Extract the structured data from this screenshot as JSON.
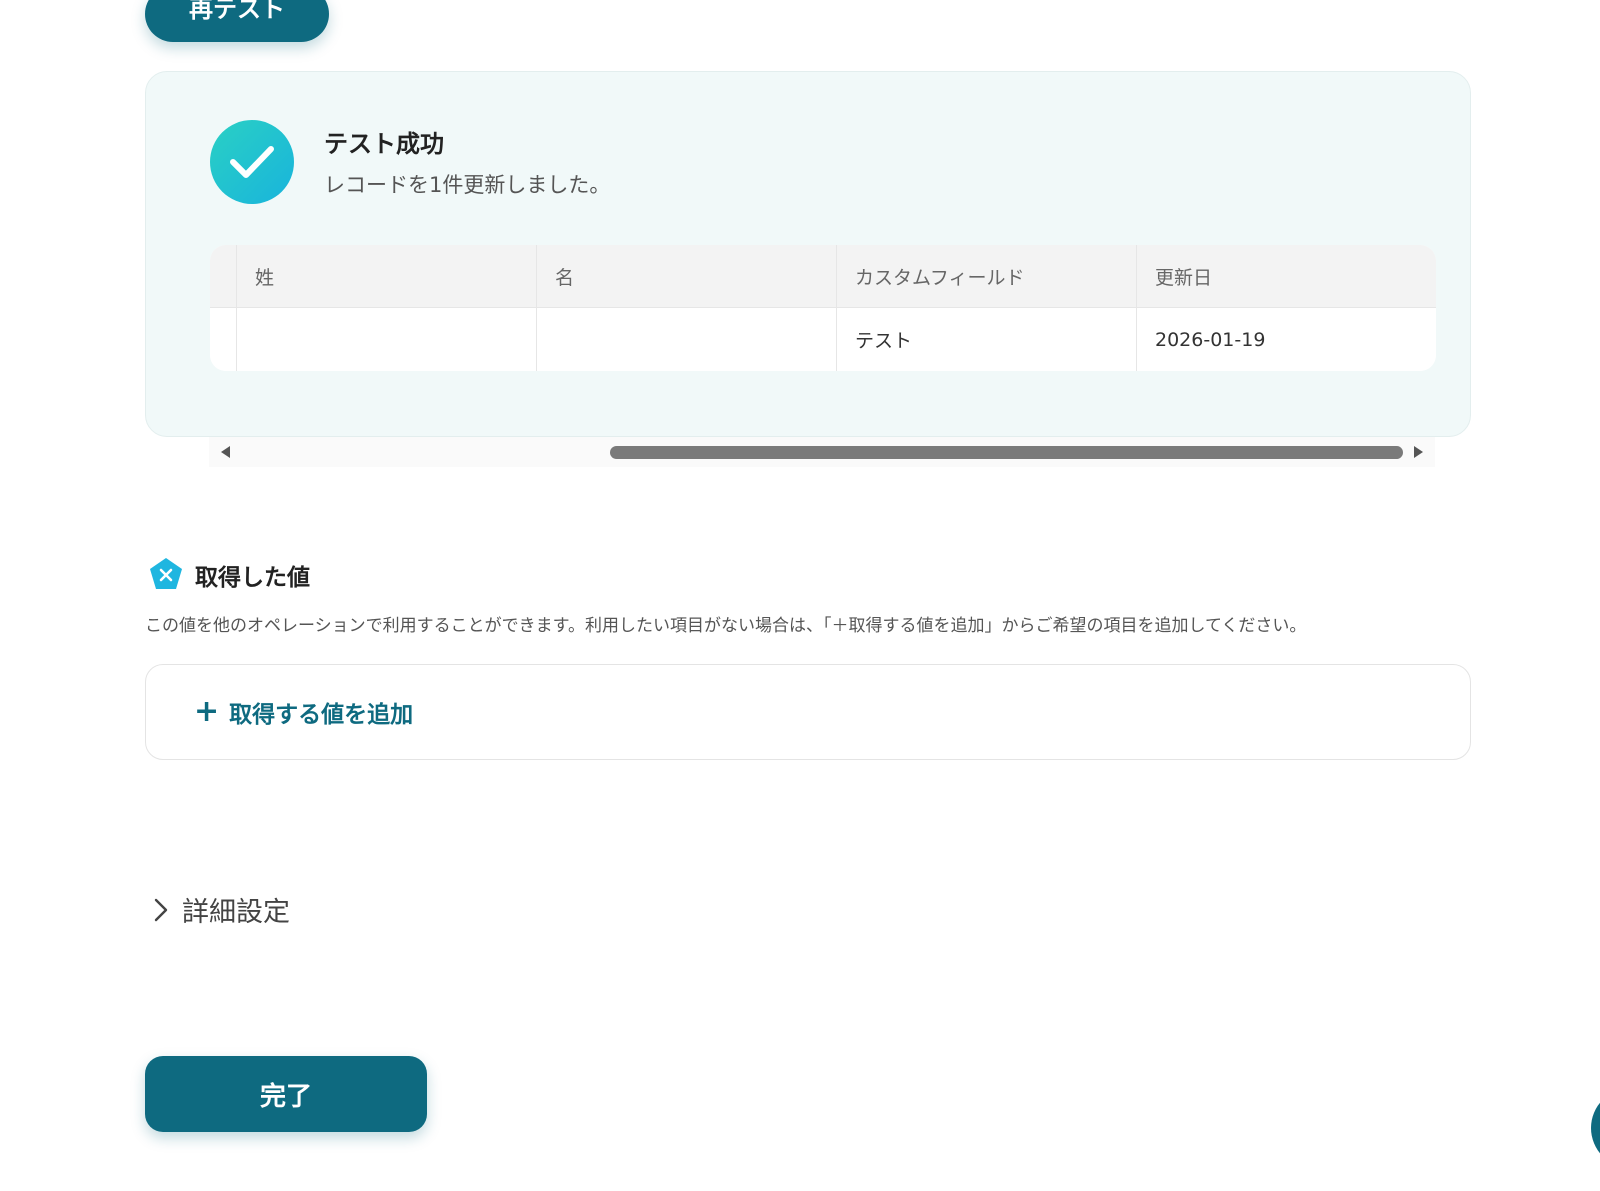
{
  "top": {
    "retest_label": "再テスト"
  },
  "result": {
    "title": "テスト成功",
    "message": "レコードを1件更新しました。",
    "table": {
      "headers": [
        "姓",
        "名",
        "カスタムフィールド",
        "更新日"
      ],
      "rows": [
        [
          "",
          "",
          "テスト",
          "2026-01-19"
        ]
      ]
    }
  },
  "retrieved": {
    "title": "取得した値",
    "description": "この値を他のオペレーションで利用することができます。利用したい項目がない場合は、「＋取得する値を追加」からご希望の項目を追加してください。",
    "add_label": "取得する値を追加"
  },
  "details": {
    "label": "詳細設定"
  },
  "footer": {
    "done_label": "完了"
  },
  "colors": {
    "primary": "#0e6a80",
    "success_gradient_start": "#2ad0c4",
    "success_gradient_end": "#19b4dc",
    "card_bg": "#f1f9f9"
  },
  "icons": [
    "check-icon",
    "variable-icon",
    "plus-icon",
    "chevron-right-icon",
    "scroll-left-arrow-icon",
    "scroll-right-arrow-icon"
  ]
}
